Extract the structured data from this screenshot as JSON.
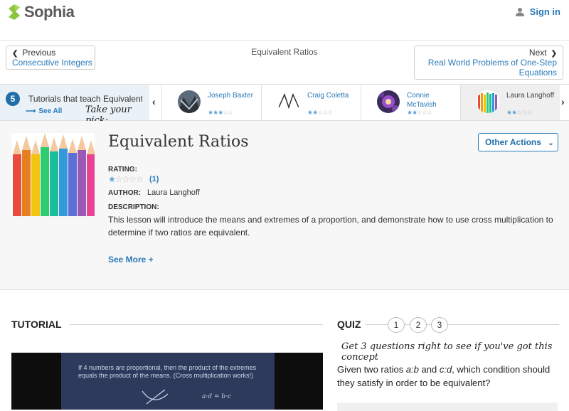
{
  "header": {
    "brand": "Sophia",
    "signin": "Sign in"
  },
  "nav": {
    "prev_label": "Previous",
    "prev_link": "Consecutive Integers",
    "title": "Equivalent Ratios",
    "next_label": "Next",
    "next_link": "Real World Problems of One-Step Equations"
  },
  "strip": {
    "count": "5",
    "tutorials_text": "Tutorials that teach Equivalent R",
    "see_all": "See All",
    "pick": "Take your pick:",
    "tutors": [
      {
        "name": "Joseph Baxter",
        "stars": 3
      },
      {
        "name": "Craig Coletta",
        "stars": 2
      },
      {
        "name": "Connie McTavish",
        "stars": 2
      },
      {
        "name": "Laura Langhoff",
        "stars": 2
      }
    ]
  },
  "lesson": {
    "title": "Equivalent Ratios",
    "other_actions": "Other Actions",
    "rating_label": "RATING:",
    "rating_stars": 1,
    "rating_count": "(1)",
    "author_label": "AUTHOR:",
    "author": "Laura Langhoff",
    "description_label": "DESCRIPTION:",
    "description": "This lesson will introduce the means and extremes of a proportion, and demonstrate how to use cross multiplication to determine if two ratios are equivalent.",
    "see_more": "See More +"
  },
  "tutorial": {
    "heading": "TUTORIAL",
    "video_text": "If 4 numbers are proportional, then the product of the extremes equals the product of the means. (Cross multiplication works!)"
  },
  "quiz": {
    "heading": "QUIZ",
    "steps": [
      "1",
      "2",
      "3"
    ],
    "note": "Get 3 questions right to see if you've got this concept",
    "question_pre": "Given two ratios ",
    "ratio_a": "a:b",
    "question_mid": " and ",
    "ratio_b": "c:d",
    "question_post": ", which condition should they satisfy in order to be equivalent?"
  },
  "colors": {
    "accent": "#2a7ab8",
    "badge": "#1f6ea9"
  }
}
